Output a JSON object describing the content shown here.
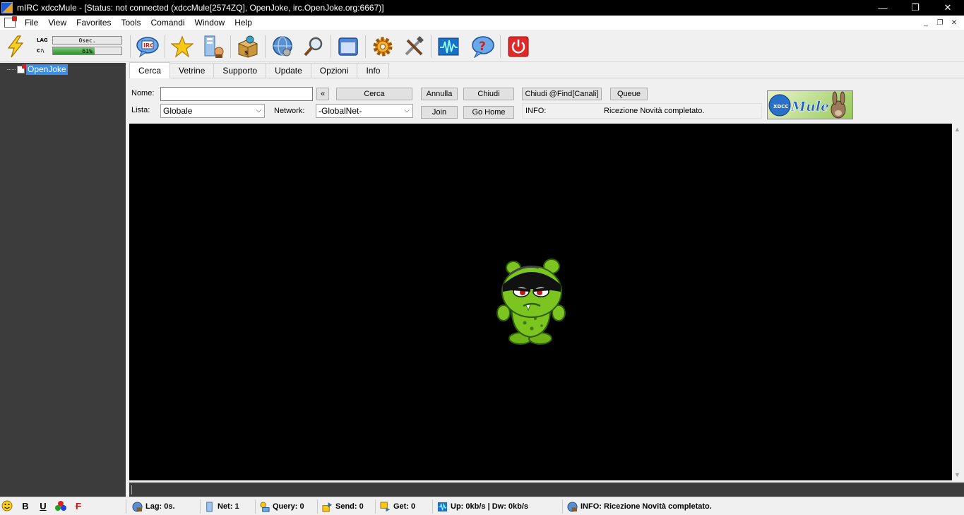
{
  "window": {
    "title": "mIRC xdccMule - [Status: not connected (xdccMule[2574ZQ], OpenJoke, irc.OpenJoke.org:6667)]",
    "minimize": "—",
    "restore": "❐",
    "close": "✕"
  },
  "menu": {
    "items": [
      "File",
      "View",
      "Favorites",
      "Tools",
      "Comandi",
      "Window",
      "Help"
    ],
    "child_minimize": "_",
    "child_restore": "❐",
    "child_close": "✕"
  },
  "meters": {
    "lag_label": "LAG",
    "lag_value": "0sec.",
    "disk_label": "C:\\",
    "disk_value": "61%",
    "disk_fraction": 0.61
  },
  "tree": {
    "network": "OpenJoke"
  },
  "tabs": [
    "Cerca",
    "Vetrine",
    "Supporto",
    "Update",
    "Opzioni",
    "Info"
  ],
  "search": {
    "name_label": "Nome:",
    "name_value": "",
    "back_button": "«",
    "search_button": "Cerca",
    "cancel_button": "Annulla",
    "close_button": "Chiudi",
    "close_find_button": "Chiudi @Find[Canali]",
    "queue_button": "Queue",
    "list_label": "Lista:",
    "list_value": "Globale",
    "network_label": "Network:",
    "network_value": "-GlobalNet-",
    "join_button": "Join",
    "home_button": "Go Home",
    "info_label": "INFO:",
    "info_message": "Ricezione Novità completato."
  },
  "logo": {
    "text": "Mule",
    "small": "XDCC"
  },
  "format": {
    "bold": "B",
    "underline": "U",
    "strike": "F"
  },
  "status": {
    "lag": "Lag: 0s.",
    "net": "Net: 1",
    "query": "Query: 0",
    "send": "Send: 0",
    "get": "Get: 0",
    "speed": "Up: 0kb/s | Dw: 0kb/s",
    "info": "INFO: Ricezione Novità completato."
  },
  "colors": {
    "accent": "#3a8ee6",
    "tree_bg": "#3c3c3c",
    "main_bg": "#000000",
    "mascot_green": "#7cc420"
  },
  "icons": {
    "toolbar": [
      "connect-icon",
      "irc-chat-icon",
      "favorites-star-icon",
      "server-book-icon",
      "package-icon",
      "globe-search-icon",
      "magnifier-icon",
      "window-icon",
      "gear-icon",
      "tools-icon",
      "waveform-icon",
      "help-icon",
      "power-icon"
    ]
  }
}
